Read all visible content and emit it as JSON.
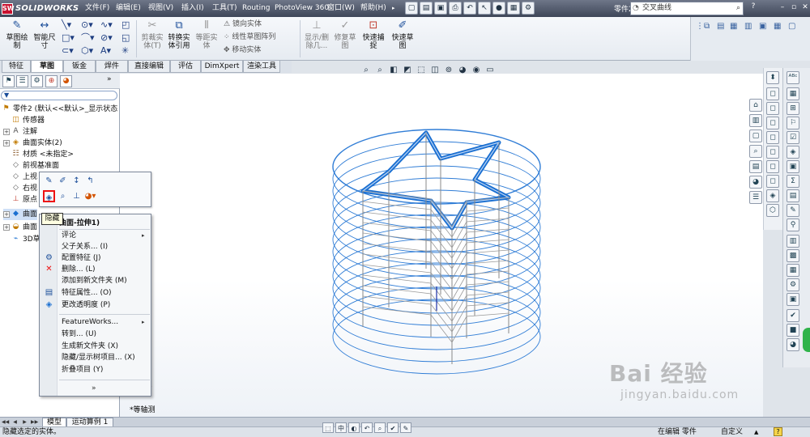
{
  "app": {
    "brand": "SOLIDWORKS",
    "logo_mark": "SW",
    "menu": [
      "文件(F)",
      "编辑(E)",
      "视图(V)",
      "插入(I)",
      "工具(T)",
      "Routing",
      "PhotoView 360",
      "窗口(W)",
      "帮助(H)"
    ],
    "doc_name": "零件2 *",
    "search_text": "交叉曲线",
    "search_user_icon": "user-icon"
  },
  "command_manager": {
    "big_buttons": [
      {
        "label": "草图绘\n制",
        "icon": "sketch-icon"
      },
      {
        "label": "智能尺\n寸",
        "icon": "smart-dimension-icon"
      }
    ],
    "disabled_buttons": [
      {
        "label": "剪裁实\n体(T)"
      },
      {
        "label": "转换实\n体引用"
      },
      {
        "label": "等距实\n体"
      }
    ],
    "small_items": [
      "镜向实体",
      "线性草图阵列",
      "移动实体"
    ],
    "right_buttons": [
      {
        "label": "显示/删\n除几..."
      },
      {
        "label": "修复草\n图"
      },
      {
        "label": "快速捕\n捉"
      },
      {
        "label": "快速草\n图"
      }
    ],
    "tabs": [
      "特征",
      "草图",
      "钣金",
      "焊件",
      "直接编辑",
      "评估",
      "DimXpert",
      "渲染工具"
    ],
    "active_tab": "草图"
  },
  "feature_tree": {
    "root": "零件2 (默认<<默认>_显示状态",
    "items": [
      {
        "label": "传感器",
        "icon": "sensor-icon",
        "expand": ""
      },
      {
        "label": "注解",
        "icon": "annotation-icon",
        "expand": "+"
      },
      {
        "label": "曲面实体(2)",
        "icon": "surface-bodies-icon",
        "expand": "+"
      },
      {
        "label": "材质 <未指定>",
        "icon": "material-icon",
        "expand": ""
      },
      {
        "label": "前视基准面",
        "icon": "plane-icon",
        "expand": ""
      },
      {
        "label": "上视",
        "icon": "plane-icon",
        "expand": ""
      },
      {
        "label": "右视",
        "icon": "plane-icon",
        "expand": ""
      },
      {
        "label": "原点",
        "icon": "origin-icon",
        "expand": ""
      },
      {
        "label": "曲面",
        "icon": "surface-extrude-icon",
        "expand": "+"
      },
      {
        "label": "曲面",
        "icon": "surface-icon",
        "expand": "+"
      },
      {
        "label": "3D草",
        "icon": "3d-sketch-icon",
        "expand": ""
      }
    ]
  },
  "context_menu": {
    "tooltip": "隐藏",
    "title": "曲面-拉伸1)",
    "items": [
      {
        "label": "评论",
        "arrow": "▸",
        "icon": ""
      },
      {
        "label": "父子关系... (I)",
        "arrow": "",
        "icon": ""
      },
      {
        "label": "配置特征 (J)",
        "arrow": "",
        "icon": "configure-feature-icon"
      },
      {
        "label": "删除... (L)",
        "arrow": "",
        "icon": "delete-icon"
      },
      {
        "label": "添加到新文件夹 (M)",
        "arrow": "",
        "icon": ""
      },
      {
        "label": "特征属性... (O)",
        "arrow": "",
        "icon": "properties-icon"
      },
      {
        "label": "更改透明度 (P)",
        "arrow": "",
        "icon": "transparency-icon"
      },
      {
        "label": "FeatureWorks...",
        "arrow": "▸",
        "icon": ""
      },
      {
        "label": "转到... (U)",
        "arrow": "",
        "icon": ""
      },
      {
        "label": "生成新文件夹 (X)",
        "arrow": "",
        "icon": ""
      },
      {
        "label": "隐藏/显示树项目... (X)",
        "arrow": "",
        "icon": ""
      },
      {
        "label": "折叠项目 (Y)",
        "arrow": "",
        "icon": ""
      }
    ],
    "more": "»"
  },
  "viewport": {
    "view_label": "*等轴测",
    "model_color": "#1a6fd1"
  },
  "bottom_tabs": [
    "模型",
    "运动算例 1"
  ],
  "status": {
    "message": "隐藏选定的实体。",
    "mode": "在编辑 零件",
    "units": "自定义",
    "help": "?"
  },
  "watermark": {
    "main": "Bai 经验",
    "sub": "jingyan.baidu.com"
  }
}
